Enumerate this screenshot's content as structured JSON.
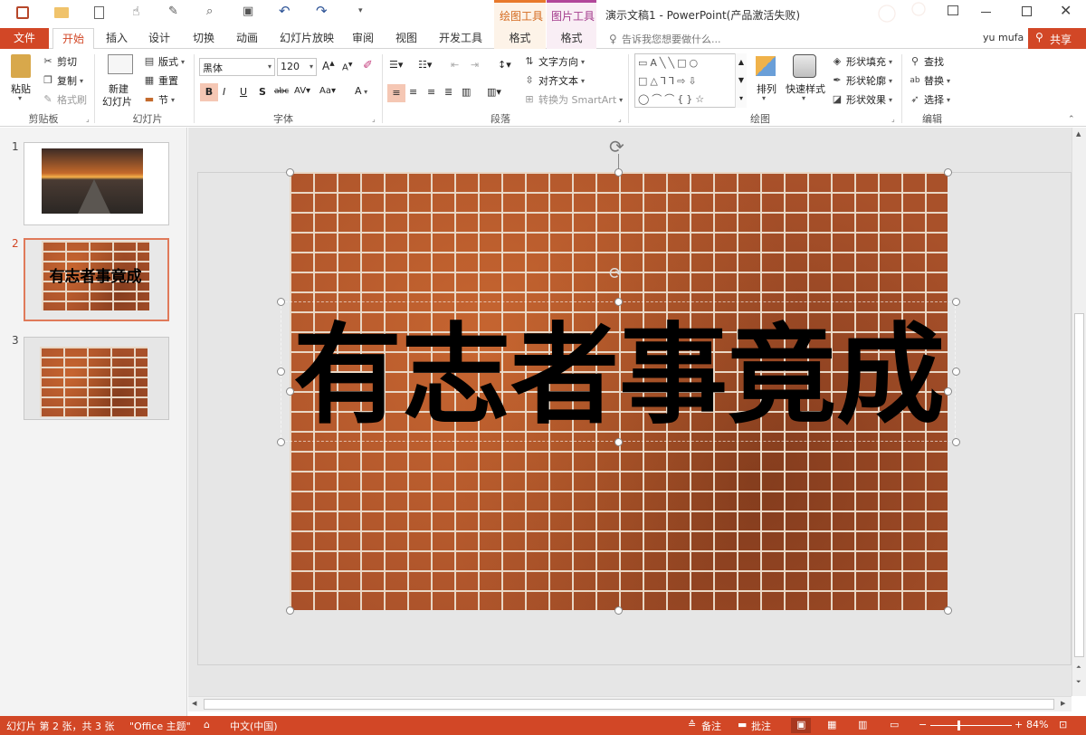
{
  "title": {
    "context_draw": "绘图工具",
    "context_pic": "图片工具",
    "window_title": "演示文稿1 - PowerPoint(产品激活失败)"
  },
  "tabs": {
    "file": "文件",
    "home": "开始",
    "insert": "插入",
    "design": "设计",
    "transitions": "切换",
    "animations": "动画",
    "slideshow": "幻灯片放映",
    "review": "审阅",
    "view": "视图",
    "developer": "开发工具",
    "format1": "格式",
    "format2": "格式",
    "tellme": "告诉我您想要做什么...",
    "user": "yu mufa",
    "share": "共享"
  },
  "ribbon": {
    "clipboard": {
      "paste": "粘贴",
      "cut": "剪切",
      "copy": "复制",
      "format_painter": "格式刷",
      "label": "剪贴板"
    },
    "slides": {
      "new_slide_1": "新建",
      "new_slide_2": "幻灯片",
      "layout": "版式",
      "reset": "重置",
      "section": "节",
      "label": "幻灯片"
    },
    "font": {
      "font_name": "黑体",
      "font_size": "120",
      "label": "字体"
    },
    "paragraph": {
      "text_direction": "文字方向",
      "align_text": "对齐文本",
      "smartart": "转换为 SmartArt",
      "label": "段落"
    },
    "drawing": {
      "arrange": "排列",
      "quick_styles": "快速样式",
      "shape_fill": "形状填充",
      "shape_outline": "形状轮廓",
      "shape_effects": "形状效果",
      "label": "绘图"
    },
    "editing": {
      "find": "查找",
      "replace": "替换",
      "select": "选择",
      "label": "编辑"
    }
  },
  "thumbnails": [
    {
      "num": "1"
    },
    {
      "num": "2",
      "text": "有志者事竟成"
    },
    {
      "num": "3"
    }
  ],
  "slide": {
    "text": "有志者事竟成"
  },
  "status": {
    "slide_info": "幻灯片 第 2 张，共 3 张",
    "theme": "\"Office 主题\"",
    "language": "中文(中国)",
    "notes": "备注",
    "comments": "批注",
    "zoom": "84%"
  },
  "colors": {
    "accent": "#d24726",
    "draw_tools": "#e8792b",
    "pic_tools": "#b1479a"
  }
}
